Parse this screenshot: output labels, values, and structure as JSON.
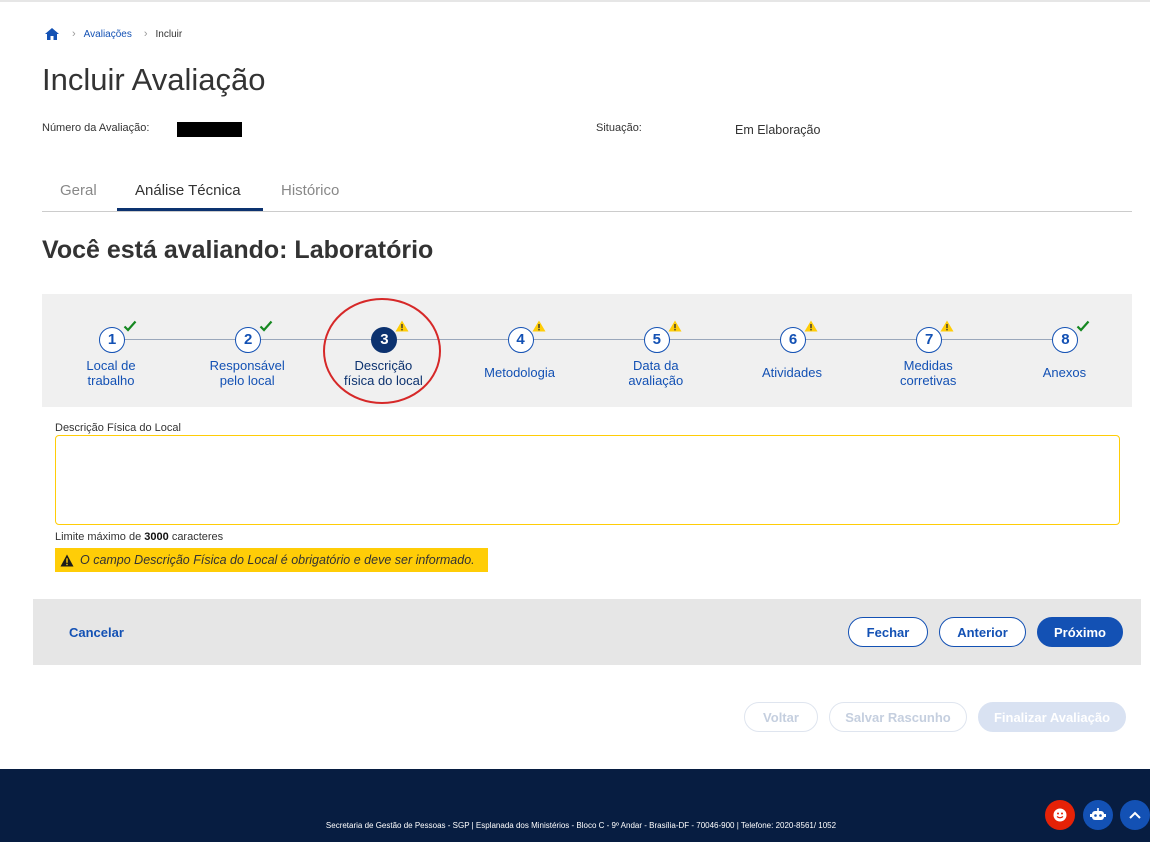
{
  "breadcrumb": {
    "home_icon": "home-icon",
    "items": [
      "Avaliações",
      "Incluir"
    ]
  },
  "page": {
    "title": "Incluir Avaliação",
    "numero_label": "Número da Avaliação:",
    "situacao_label": "Situação:",
    "situacao_value": "Em Elaboração"
  },
  "tabs": [
    {
      "label": "Geral",
      "active": false
    },
    {
      "label": "Análise Técnica",
      "active": true
    },
    {
      "label": "Histórico",
      "active": false
    }
  ],
  "section": {
    "title": "Você está avaliando: Laboratório"
  },
  "steps": [
    {
      "number": "1",
      "label_lines": [
        "Local de",
        "trabalho"
      ],
      "status": "check"
    },
    {
      "number": "2",
      "label_lines": [
        "Responsável",
        "pelo local"
      ],
      "status": "check"
    },
    {
      "number": "3",
      "label_lines": [
        "Descrição",
        "física do local"
      ],
      "status": "warning",
      "current": true
    },
    {
      "number": "4",
      "label_lines": [
        "Metodologia"
      ],
      "status": "warning"
    },
    {
      "number": "5",
      "label_lines": [
        "Data da",
        "avaliação"
      ],
      "status": "warning"
    },
    {
      "number": "6",
      "label_lines": [
        "Atividades"
      ],
      "status": "warning"
    },
    {
      "number": "7",
      "label_lines": [
        "Medidas",
        "corretivas"
      ],
      "status": "warning"
    },
    {
      "number": "8",
      "label_lines": [
        "Anexos"
      ],
      "status": "check"
    }
  ],
  "field": {
    "label": "Descrição Física do Local",
    "value": "",
    "limit_prefix": "Limite máximo de",
    "limit_value": "3000",
    "limit_suffix": "caracteres",
    "error": "O campo Descrição Física do Local é obrigatório e deve ser informado."
  },
  "actions": {
    "cancel": "Cancelar",
    "close": "Fechar",
    "previous": "Anterior",
    "next": "Próximo",
    "back": "Voltar",
    "save_draft": "Salvar Rascunho",
    "finish": "Finalizar Avaliação"
  },
  "footer": {
    "text": "Secretaria de Gestão de Pessoas - SGP | Esplanada dos Ministérios - Bloco C - 9º Andar - Brasília-DF - 70046-900 | Telefone: 2020-8561/ 1052"
  },
  "colors": {
    "primary": "#1351b4",
    "dark_blue": "#0c326f",
    "warning": "#ffcd07",
    "success": "#168821",
    "footer_bg": "#071d41",
    "annotation_red": "#d62828"
  }
}
